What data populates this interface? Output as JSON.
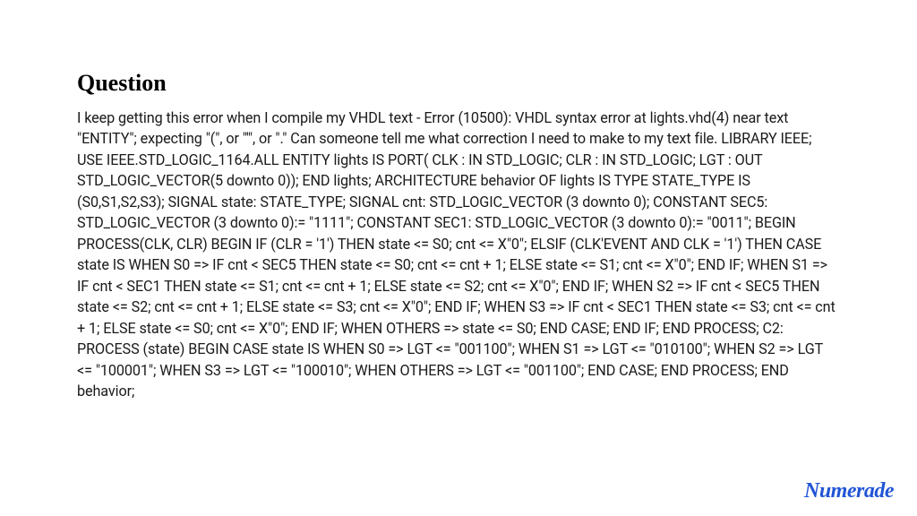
{
  "heading": "Question",
  "body": "I keep getting this error when I compile my VHDL text - Error (10500): VHDL syntax error at lights.vhd(4) near text \"ENTITY\"; expecting \"(\", or \"'\", or \".\" Can someone tell me what correction I need to make to my text file. LIBRARY IEEE; USE IEEE.STD_LOGIC_1164.ALL ENTITY lights IS PORT( CLK : IN STD_LOGIC; CLR : IN STD_LOGIC; LGT : OUT STD_LOGIC_VECTOR(5 downto 0)); END lights; ARCHITECTURE behavior OF lights IS TYPE STATE_TYPE IS (S0,S1,S2,S3); SIGNAL state: STATE_TYPE; SIGNAL cnt: STD_LOGIC_VECTOR (3 downto 0); CONSTANT SEC5: STD_LOGIC_VECTOR (3 downto 0):= \"1111\"; CONSTANT SEC1: STD_LOGIC_VECTOR (3 downto 0):= \"0011\"; BEGIN PROCESS(CLK, CLR) BEGIN IF (CLR = '1') THEN state <= S0; cnt <= X\"0\"; ELSIF (CLK'EVENT AND CLK = '1') THEN CASE state IS WHEN S0 => IF cnt < SEC5 THEN state <= S0; cnt <= cnt + 1; ELSE state <= S1; cnt <= X\"0\"; END IF; WHEN S1 => IF cnt < SEC1 THEN state <= S1; cnt <= cnt + 1; ELSE state <= S2; cnt <= X\"0\"; END IF; WHEN S2 => IF cnt < SEC5 THEN state <= S2; cnt <= cnt + 1; ELSE state <= S3; cnt <= X\"0\"; END IF; WHEN S3 => IF cnt < SEC1 THEN state <= S3; cnt <= cnt + 1; ELSE state <= S0; cnt <= X\"0\"; END IF; WHEN OTHERS => state <= S0; END CASE; END IF; END PROCESS; C2: PROCESS (state) BEGIN CASE state IS WHEN S0 => LGT <= \"001100\"; WHEN S1 => LGT <= \"010100\"; WHEN S2 => LGT <= \"100001\"; WHEN S3 => LGT <= \"100010\"; WHEN OTHERS => LGT <= \"001100\"; END CASE; END PROCESS; END behavior;",
  "logo": "Numerade"
}
